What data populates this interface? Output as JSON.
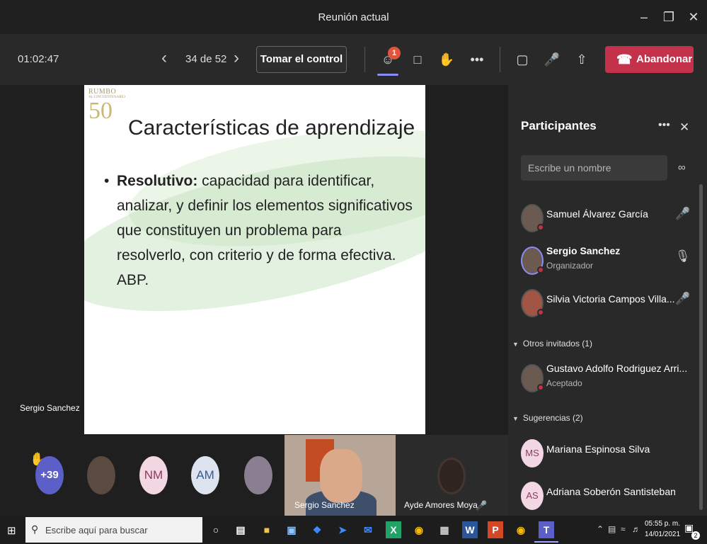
{
  "window": {
    "title": "Reunión actual",
    "minimize_icon": "minimize-icon",
    "maximize_icon": "maximize-icon",
    "close_icon": "close-icon"
  },
  "toolbar": {
    "timer": "01:02:47",
    "page_indicator": "34 de 52",
    "take_control": "Tomar el control",
    "participants_badge": "1",
    "leave": "Abandonar",
    "icons": [
      "chevron-left-icon",
      "chevron-right-icon",
      "participants-icon",
      "chat-icon",
      "raise-hand-icon",
      "more-icon",
      "camera-off-icon",
      "mic-off-icon",
      "share-icon",
      "phone-icon"
    ]
  },
  "slide": {
    "logo_line1": "RUMBO",
    "logo_line2": "AL CINCUENTENARIO",
    "logo_line3": "50",
    "heading": "Características de aprendizaje",
    "bullet_bold": "Resolutivo:",
    "bullet_text": " capacidad para identificar, analizar, y definir los elementos significativos que constituyen un problema para resolverlo, con criterio y de forma efectiva. ABP."
  },
  "stage": {
    "presenter_label": "Sergio Sanchez",
    "more_count": "+39",
    "avatars": [
      {
        "initials": "NM"
      },
      {
        "initials": "AM"
      }
    ],
    "video1_label": "Sergio Sanchez",
    "video2_label": "Ayde Amores Moya"
  },
  "panel": {
    "title": "Participantes",
    "search_placeholder": "Escribe un nombre",
    "participants": [
      {
        "name": "Samuel Álvarez García",
        "sub": "",
        "mic": "mic-off-icon"
      },
      {
        "name": "Sergio Sanchez",
        "sub": "Organizador",
        "mic": "mic-icon"
      },
      {
        "name": "Silvia Victoria Campos Villa...",
        "sub": "",
        "mic": "mic-off-icon"
      }
    ],
    "section_guests": "Otros invitados (1)",
    "guests": [
      {
        "name": "Gustavo Adolfo Rodriguez Arri...",
        "sub": "Aceptado"
      }
    ],
    "section_suggestions": "Sugerencias (2)",
    "suggestions": [
      {
        "initials": "MS",
        "name": "Mariana Espinosa Silva"
      },
      {
        "initials": "AS",
        "name": "Adriana Soberón Santisteban"
      }
    ]
  },
  "taskbar": {
    "search_placeholder": "Escribe aquí para buscar",
    "clock_time": "05:55 p. m.",
    "clock_date": "14/01/2021",
    "notification_count": "2"
  }
}
